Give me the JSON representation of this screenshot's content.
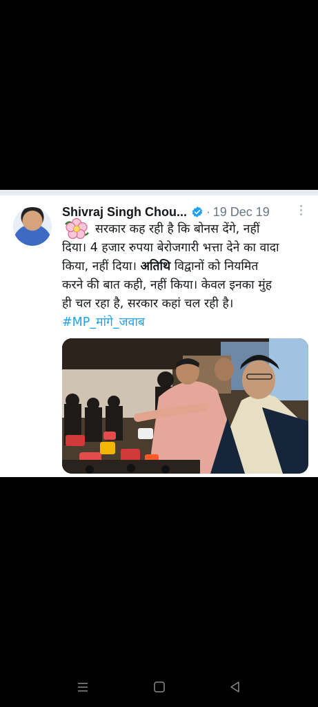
{
  "tweet": {
    "author_name": "Shivraj Singh Chou...",
    "separator": "·",
    "date": "19 Dec 19",
    "text": {
      "line1": "सरकार कह रही है कि बोनस देंगे, नहीं",
      "line2": "दिया। 4 हजार रुपया बेरोजगारी भत्ता देने का वादा",
      "line3_before": "किया, नहीं दिया। ",
      "line3_bold": "अतिथि",
      "line3_after": " विद्वानों को नियमित",
      "line4": "करने की बात कही, नहीं किया। केवल इनका मुंह",
      "line5": "ही चल रहा है, सरकार कहां चल रही है।",
      "hashtag": "#MP_मांगे_जवाब"
    }
  },
  "icons": {
    "verified": "verified-badge-icon",
    "more": "more-options-icon",
    "flower": "flower-emoji-icon"
  },
  "colors": {
    "link": "#1da1f2",
    "verified": "#1da1f2",
    "text": "#14171a",
    "secondary": "#657786"
  },
  "navigation": {
    "buttons": [
      "menu-icon",
      "home-icon",
      "back-icon"
    ]
  }
}
